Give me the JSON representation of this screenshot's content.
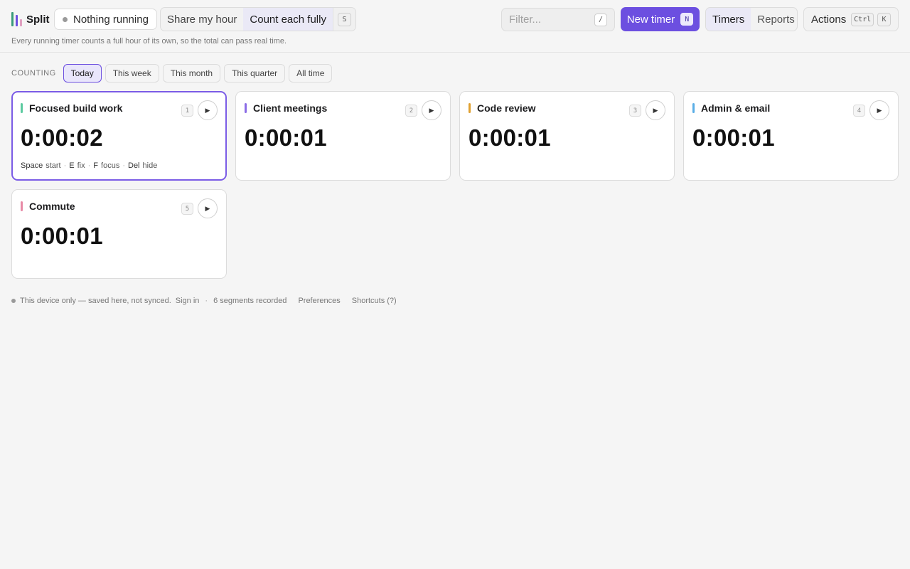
{
  "app": {
    "title": "Split",
    "logo_colors": [
      "#3a9a7a",
      "#6c4fe0",
      "#e0a0c0"
    ]
  },
  "status": {
    "text": "Nothing running"
  },
  "mode": {
    "options": [
      "Share my hour",
      "Count each fully"
    ],
    "active": 1,
    "shortcut": "S"
  },
  "subtitle": "Every running timer counts a full hour of its own, so the total can pass real time.",
  "filter": {
    "placeholder": "Filter...",
    "shortcut": "/"
  },
  "new_timer": {
    "label": "New timer",
    "shortcut": "N"
  },
  "view": {
    "options": [
      "Timers",
      "Reports"
    ],
    "active": 0
  },
  "actions": {
    "label": "Actions",
    "shortcut_mod": "Ctrl",
    "shortcut_key": "K"
  },
  "range": {
    "label": "COUNTING",
    "options": [
      "Today",
      "This week",
      "This month",
      "This quarter",
      "All time"
    ],
    "active": 0
  },
  "timers": [
    {
      "name": "Focused build work",
      "color": "#5ccaa0",
      "index": "1",
      "time": "0:00:02",
      "selected": true
    },
    {
      "name": "Client meetings",
      "color": "#8b6ce6",
      "index": "2",
      "time": "0:00:01",
      "selected": false
    },
    {
      "name": "Code review",
      "color": "#e0a030",
      "index": "3",
      "time": "0:00:01",
      "selected": false
    },
    {
      "name": "Admin & email",
      "color": "#5aaee6",
      "index": "4",
      "time": "0:00:01",
      "selected": false
    },
    {
      "name": "Commute",
      "color": "#e88aa6",
      "index": "5",
      "time": "0:00:01",
      "selected": false
    }
  ],
  "hints": [
    {
      "key": "Space",
      "action": "start"
    },
    {
      "key": "E",
      "action": "fix"
    },
    {
      "key": "F",
      "action": "focus"
    },
    {
      "key": "Del",
      "action": "hide"
    }
  ],
  "footer": {
    "device_text": "This device only — saved here, not synced.",
    "sign_in": "Sign in",
    "segments": "6 segments recorded",
    "preferences": "Preferences",
    "shortcuts": "Shortcuts (?)"
  }
}
